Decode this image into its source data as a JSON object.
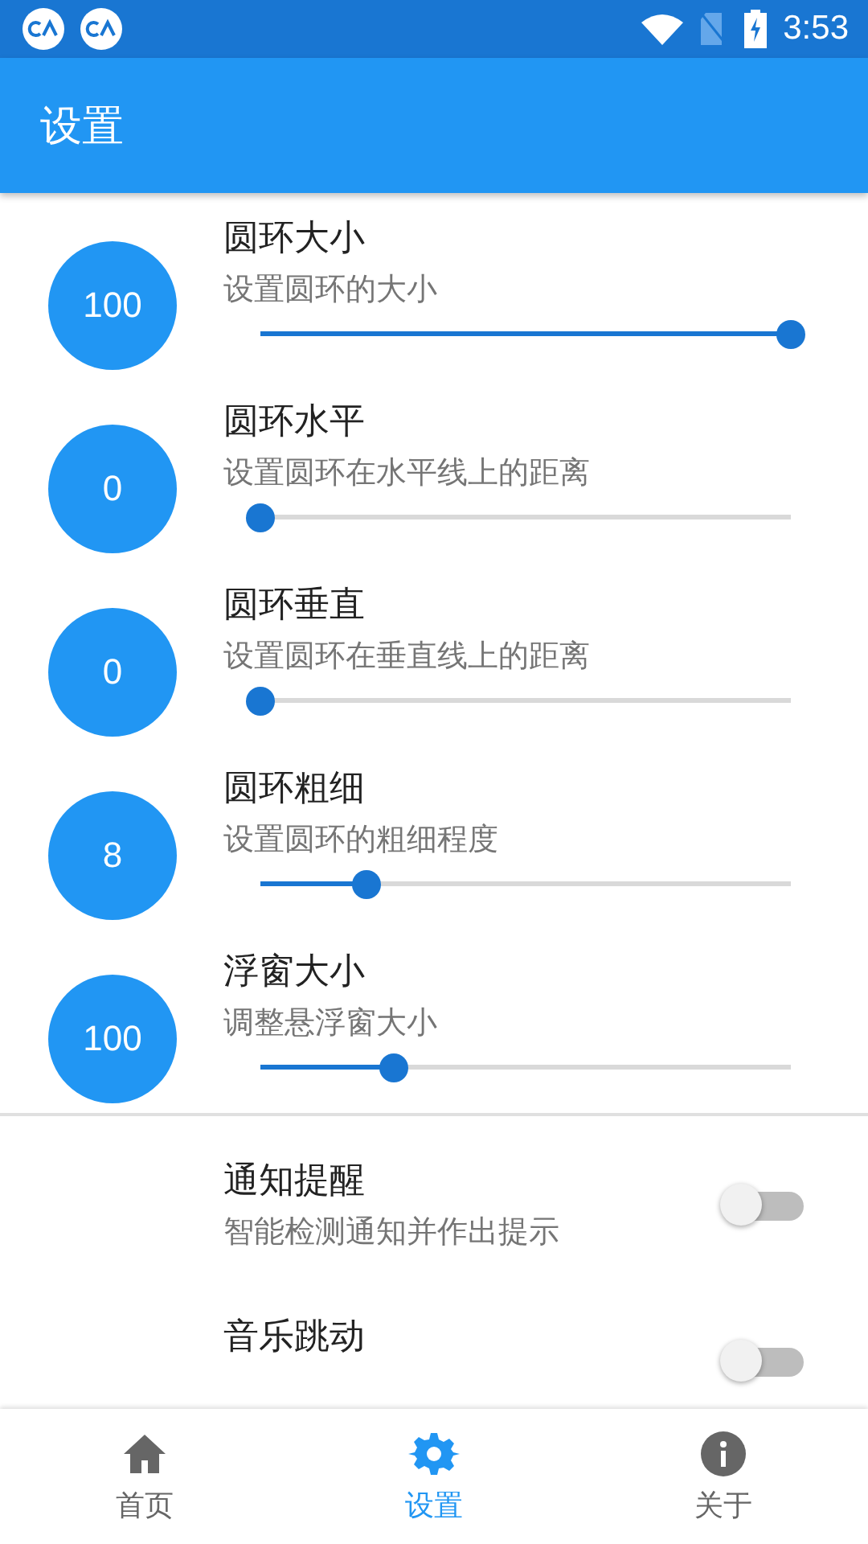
{
  "status_bar": {
    "time": "3:53"
  },
  "app_bar": {
    "title": "设置"
  },
  "sliders": [
    {
      "value": "100",
      "title": "圆环大小",
      "subtitle": "设置圆环的大小",
      "level": 1.0
    },
    {
      "value": "0",
      "title": "圆环水平",
      "subtitle": "设置圆环在水平线上的距离",
      "level": 0
    },
    {
      "value": "0",
      "title": "圆环垂直",
      "subtitle": "设置圆环在垂直线上的距离",
      "level": 0
    },
    {
      "value": "8",
      "title": "圆环粗细",
      "subtitle": "设置圆环的粗细程度",
      "level": 0.2
    },
    {
      "value": "100",
      "title": "浮窗大小",
      "subtitle": "调整悬浮窗大小",
      "level": 0.25
    }
  ],
  "switches": [
    {
      "title": "通知提醒",
      "subtitle": "智能检测通知并作出提示",
      "on": false
    },
    {
      "title": "音乐跳动",
      "on": false
    }
  ],
  "bottom_nav": [
    {
      "label": "首页",
      "selected": false
    },
    {
      "label": "设置",
      "selected": true
    },
    {
      "label": "关于",
      "selected": false
    }
  ]
}
